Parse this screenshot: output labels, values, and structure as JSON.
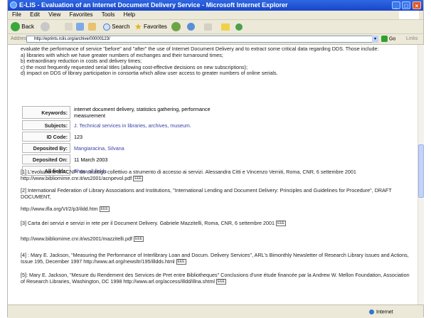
{
  "window": {
    "title": "E-LIS - Evaluation of an Internet Document Delivery Service - Microsoft Internet Explorer",
    "buttons": {
      "minimize": "_",
      "maximize": "□",
      "close": "×"
    }
  },
  "menu": [
    "File",
    "Edit",
    "View",
    "Favorites",
    "Tools",
    "Help"
  ],
  "toolbar": {
    "back": "Back",
    "search": "Search",
    "favorites": "Favorites"
  },
  "address": {
    "label": "Address",
    "url": "http://eprints.rclis.org/archive/00000123/",
    "go": "Go",
    "links": "Links"
  },
  "abstract": {
    "intro": "evaluate the performance of service \"before\" and \"after\" the use of Internet Document Delivery and to extract some critical data regarding DDS. Those include:",
    "items": [
      "a) libraries with which we have greater numbers of exchanges and their turnaround times;",
      "b) extraordinary reduction in costs and delivery times;",
      "c) the most frequently requested serial titles (allowing cost-effective decisions on new subscriptions);",
      "d) impact on DDS of library participation in consortia which allow user access to greater numbers of online serials."
    ]
  },
  "metadata": [
    {
      "key": "Keywords:",
      "value": "internet document delivery, statistics gathering, performance measurement",
      "link": false
    },
    {
      "key": "Subjects:",
      "value": "J. Technical services in libraries, archives, museum.",
      "link": true
    },
    {
      "key": "ID Code:",
      "value": "123",
      "link": false
    },
    {
      "key": "Deposited By:",
      "value": "Mangiaracina, Silvana",
      "link": true
    },
    {
      "key": "Deposited On:",
      "value": "11 March 2003",
      "link": false
    },
    {
      "key": "All fields:",
      "value": "Show all fields",
      "link": true
    }
  ],
  "xref_label": "EEE",
  "references": [
    "[1] L'evoluzione di ACNP: da catalogo collettivo a strumento di accesso ai servizi. Alessandra Citti e Vincenzo Verniti, Roma, CNR, 6 settembre 2001 http://www.bibliomime.cnr.it/ws2001/acnpevol.pdf",
    "[2] International Federation of Library Associations and Institutions, \"International Lending and Document Delivery: Principles and Guidelines for Procedure\", DRAFT DOCUMENT,",
    "http://www.ifla.org/VI/2/p3/ildd.htm",
    "[3] Carta dei servizi e servizi in rete per il Document Delivery. Gabriele Mazzitelli, Roma, CNR, 6 settembre 2001",
    "http://www.bibliomime.cnr.it/ws2001/mazzitelli.pdf",
    "[4] : Mary E. Jackson, \"Measuring the Performance of Interlibrary Loan and Docum. Delivery Services\", ARL's Bimonthly Newsletter of Research Library Issues and Actions, Issue 195, December 1997 http://www.arl.org/newsltr/195/illdds.html",
    "[5]: Mary E. Jackson, \"Mesure du Rendement des Services de Pret entre Bibliotheques\" Conclusions d'une étude financée par la Andrew W. Mellon Foundation, Association of Research Libraries, Washington, DC 1998 http://www.arl.org/access/illdd/illna.shtml"
  ],
  "status": {
    "zone": "Internet"
  },
  "colors": {
    "titlebar": "#2358d8",
    "link": "#3b43a6",
    "chrome": "#ece9d8"
  }
}
